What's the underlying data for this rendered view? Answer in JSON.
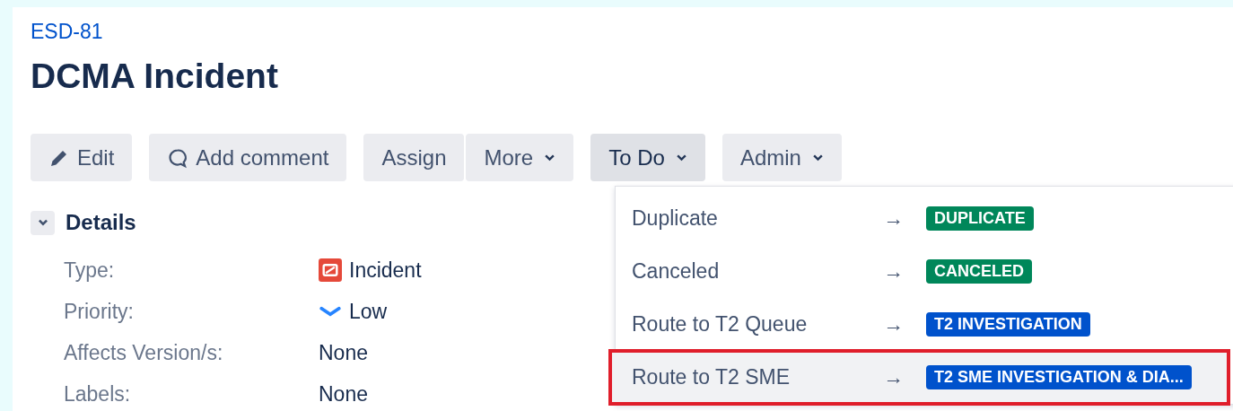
{
  "issue": {
    "key": "ESD-81",
    "title": "DCMA Incident"
  },
  "toolbar": [
    {
      "buttons": [
        {
          "label": "Edit",
          "kind": "edit"
        }
      ]
    },
    {
      "buttons": [
        {
          "label": "Add comment",
          "kind": "comment"
        }
      ]
    },
    {
      "buttons": [
        {
          "label": "Assign",
          "kind": "plain"
        },
        {
          "label": "More",
          "kind": "dropdown",
          "expanded": false
        }
      ]
    },
    {
      "buttons": [
        {
          "label": "To Do",
          "kind": "dropdown",
          "expanded": true
        }
      ]
    },
    {
      "buttons": [
        {
          "label": "Admin",
          "kind": "dropdown",
          "expanded": false
        }
      ]
    }
  ],
  "details": {
    "title": "Details",
    "expanded": true,
    "fields": [
      {
        "label": "Type:",
        "value": "Incident",
        "kind": "issue-type"
      },
      {
        "label": "Priority:",
        "value": "Low",
        "kind": "priority"
      },
      {
        "label": "Affects Version/s:",
        "value": "None",
        "kind": "plain"
      },
      {
        "label": "Labels:",
        "value": "None",
        "kind": "plain"
      }
    ]
  },
  "transitions": [
    {
      "label": "Duplicate",
      "arrow": "→",
      "status": "DUPLICATE",
      "color": "#00875a",
      "selected": false
    },
    {
      "label": "Canceled",
      "arrow": "→",
      "status": "CANCELED",
      "color": "#00875a",
      "selected": false
    },
    {
      "label": "Route to T2 Queue",
      "arrow": "→",
      "status": "T2 INVESTIGATION",
      "color": "#0052cc",
      "selected": false
    },
    {
      "label": "Route to T2 SME",
      "arrow": "→",
      "status": "T2 SME INVESTIGATION & DIA...",
      "color": "#0052cc",
      "selected": true
    }
  ]
}
